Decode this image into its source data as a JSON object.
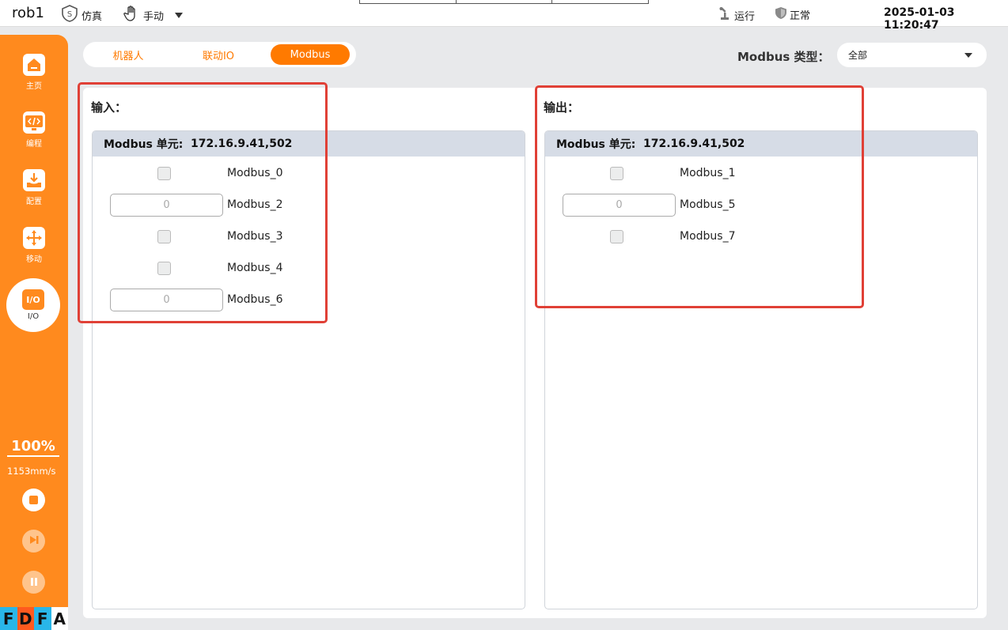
{
  "topbar": {
    "robot_name": "rob1",
    "sim_badge": "S",
    "sim_label": "仿真",
    "manual_label": "手动",
    "run_label": "运行",
    "status_label": "正常",
    "datetime": "2025-01-03 11:20:47"
  },
  "sidebar": {
    "items": [
      {
        "label": "主页",
        "icon": "home-icon"
      },
      {
        "label": "编程",
        "icon": "code-icon"
      },
      {
        "label": "配置",
        "icon": "download-config-icon"
      },
      {
        "label": "移动",
        "icon": "move-arrows-icon"
      }
    ],
    "active": {
      "label": "I/O",
      "icon_text": "I/O"
    },
    "speed_percent": "100%",
    "speed_mm": "1153mm/s",
    "fdfa": [
      "F",
      "D",
      "F",
      "A"
    ]
  },
  "tabs": [
    "机器人",
    "联动IO",
    "Modbus"
  ],
  "active_tab": 2,
  "modbus_type": {
    "label": "Modbus 类型：",
    "value": "全部"
  },
  "input": {
    "title": "输入：",
    "unit_label": "Modbus 单元:",
    "unit_value": "172.16.9.41,502",
    "rows": [
      {
        "kind": "checkbox",
        "name": "Modbus_0"
      },
      {
        "kind": "number",
        "name": "Modbus_2",
        "value": "0"
      },
      {
        "kind": "checkbox",
        "name": "Modbus_3"
      },
      {
        "kind": "checkbox",
        "name": "Modbus_4"
      },
      {
        "kind": "number",
        "name": "Modbus_6",
        "value": "0"
      }
    ]
  },
  "output": {
    "title": "输出：",
    "unit_label": "Modbus 单元:",
    "unit_value": "172.16.9.41,502",
    "rows": [
      {
        "kind": "checkbox",
        "name": "Modbus_1"
      },
      {
        "kind": "number",
        "name": "Modbus_5",
        "value": "0"
      },
      {
        "kind": "checkbox",
        "name": "Modbus_7"
      }
    ]
  },
  "colors": {
    "accent": "#ff7a00",
    "sidebar": "#ff8a1e",
    "highlight": "#e04036",
    "fdfa_f": "#29b6e8",
    "fdfa_d": "#ff5a1e"
  }
}
